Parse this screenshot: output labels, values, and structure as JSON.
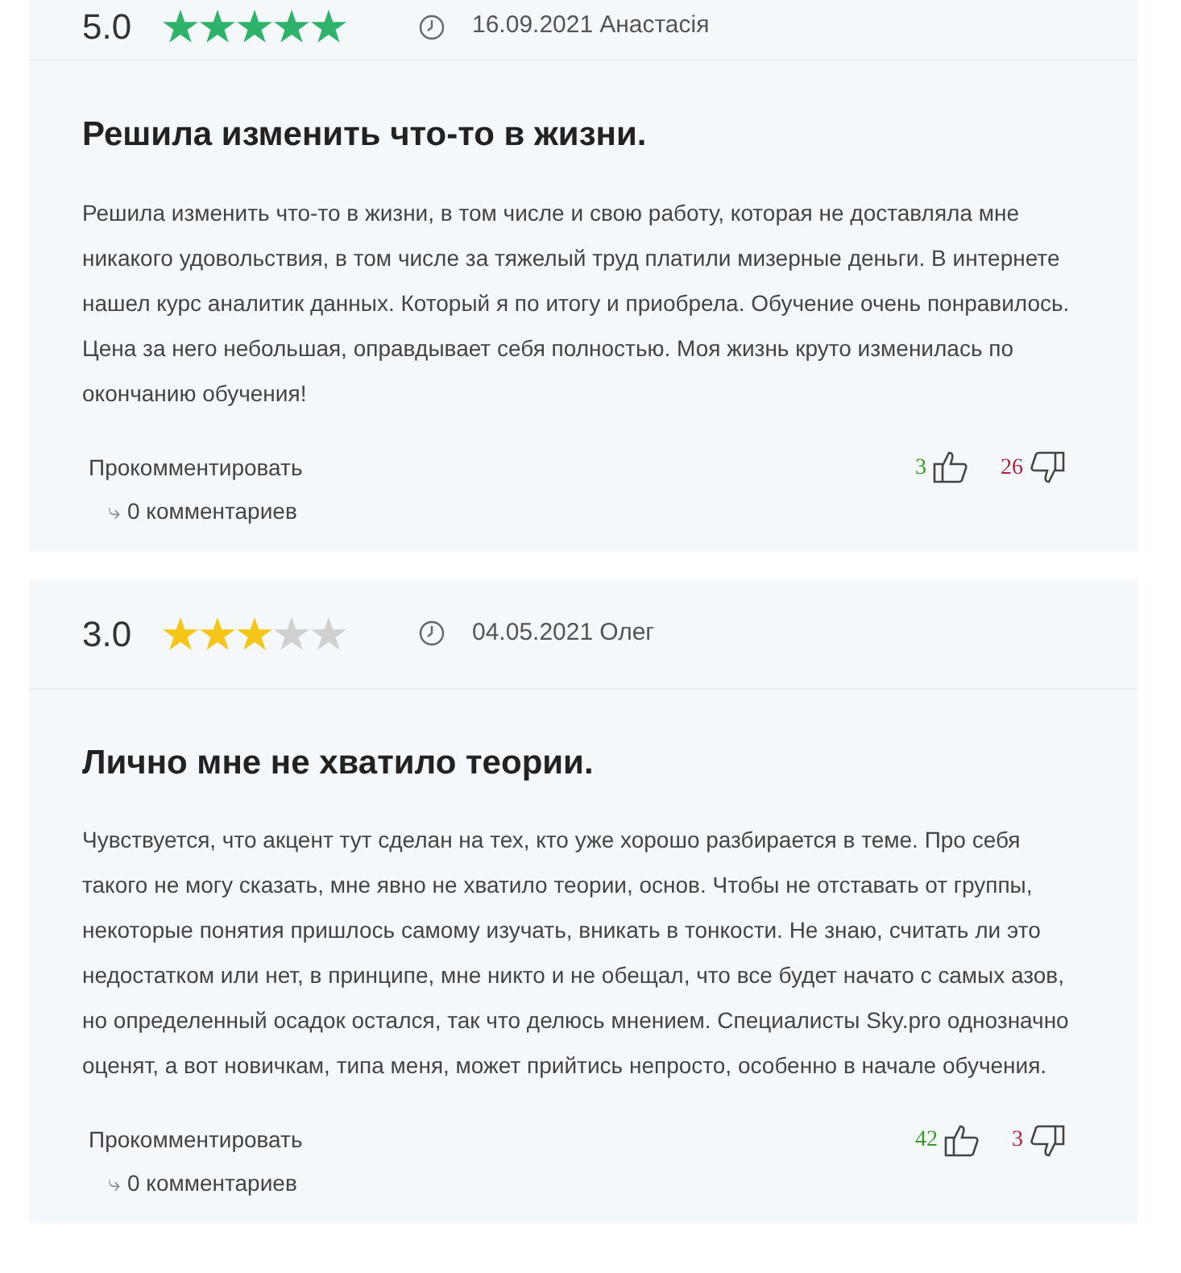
{
  "reviews": [
    {
      "score": "5.0",
      "stars": 5,
      "color": "#2fb36b",
      "date": "16.09.2021",
      "author": "Анастасія",
      "title": "Решила изменить что-то в жизни.",
      "text": "Решила изменить что-то в жизни, в том числе и свою работу, которая не доставляла мне никакого удовольствия, в том числе за тяжелый труд платили мизерные деньги. В интернете нашел курс аналитик данных. Который я по итогу и приобрела. Обучение очень понравилось. Цена за него небольшая, оправдывает себя полностью. Моя жизнь круто изменилась по окончанию обучения!",
      "comment_link": "Прокомментировать",
      "reply_icon": "⤷",
      "comments": "0 комментариев",
      "likes": "3",
      "dislikes": "26"
    },
    {
      "score": "3.0",
      "stars": 3,
      "color": "#f5c518",
      "date": "04.05.2021",
      "author": "Олег",
      "title": "Лично мне не хватило теории.",
      "text": "Чувствуется, что акцент тут сделан на тех, кто уже хорошо разбирается в теме. Про себя такого не могу сказать, мне явно не хватило теории, основ. Чтобы не отставать от группы, некоторые понятия пришлось самому изучать, вникать в тонкости. Не знаю, считать ли это недостатком или нет, в принципе, мне никто и не обещал, что все будет начато с самых азов, но определенный осадок остался, так что делюсь мнением. Специалисты Sky.pro однозначно оценят, а вот новичкам, типа меня, может прийтись непросто, особенно в начале обучения.",
      "comment_link": "Прокомментировать",
      "reply_icon": "⤷",
      "comments": "0 комментариев",
      "likes": "42",
      "dislikes": "3"
    }
  ]
}
